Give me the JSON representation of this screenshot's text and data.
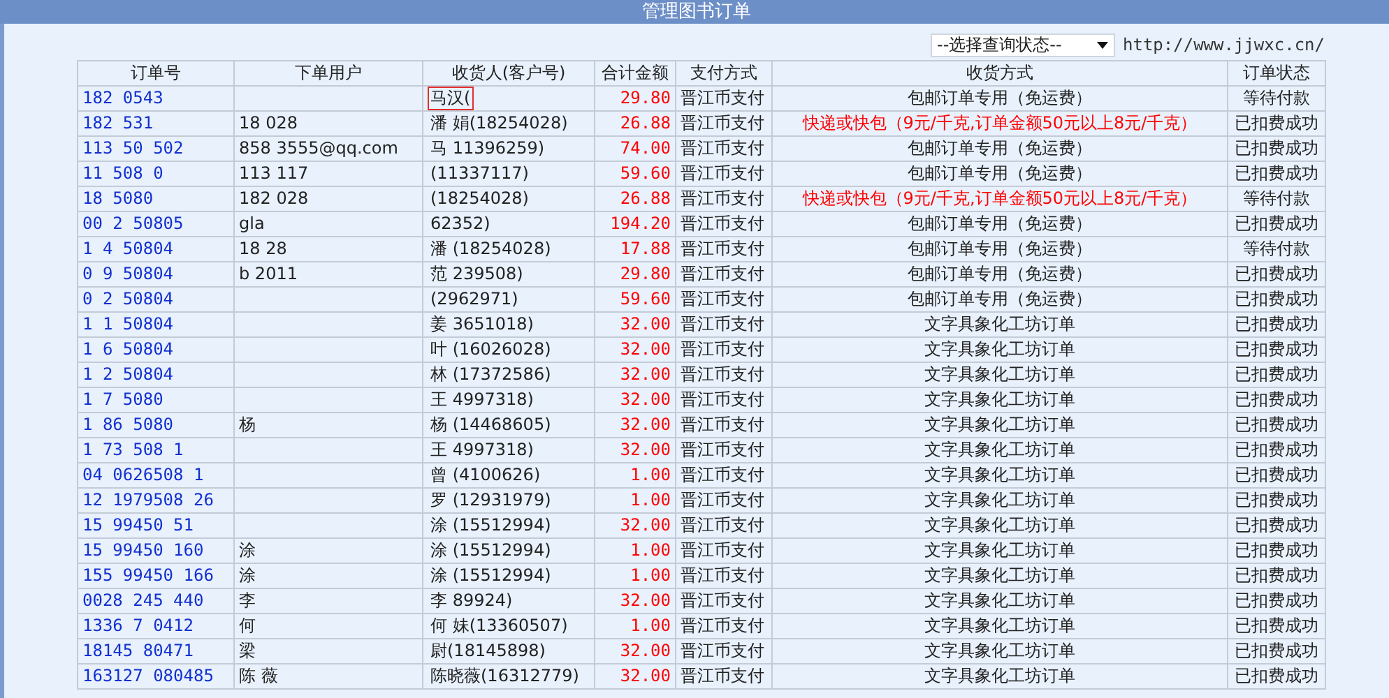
{
  "title": "管理图书订单",
  "status_filter": {
    "value": "--选择查询状态--"
  },
  "site_url": "http://www.jjwxc.cn/",
  "columns": [
    "订单号",
    "下单用户",
    "收货人(客户号)",
    "合计金额",
    "支付方式",
    "收货方式",
    "订单状态"
  ],
  "rows": [
    {
      "order": "182 0543",
      "consignee": "马汉(",
      "consignee_marked": true,
      "amount": "29.80",
      "payment": "晋江币支付",
      "shipping": "包邮订单专用（免运费）",
      "shipping_highlight": false,
      "status": "等待付款"
    },
    {
      "order": "182 531",
      "user": "18 028",
      "consignee": "潘 娟(18254028)",
      "consignee_marked": false,
      "amount": "26.88",
      "payment": "晋江币支付",
      "shipping": "快递或快包（9元/千克,订单金额50元以上8元/千克）",
      "shipping_highlight": true,
      "status": "已扣费成功"
    },
    {
      "order": "113 50 502",
      "user": "858 3555@qq.com",
      "consignee": "马 11396259)",
      "consignee_marked": false,
      "amount": "74.00",
      "payment": "晋江币支付",
      "shipping": "包邮订单专用（免运费）",
      "shipping_highlight": false,
      "status": "已扣费成功"
    },
    {
      "order": "11 508 0",
      "user": "113 117",
      "consignee": "(11337117)",
      "consignee_marked": false,
      "amount": "59.60",
      "payment": "晋江币支付",
      "shipping": "包邮订单专用（免运费）",
      "shipping_highlight": false,
      "status": "已扣费成功"
    },
    {
      "order": "18 5080",
      "user": "182 028",
      "consignee": "(18254028)",
      "consignee_marked": false,
      "amount": "26.88",
      "payment": "晋江币支付",
      "shipping": "快递或快包（9元/千克,订单金额50元以上8元/千克）",
      "shipping_highlight": true,
      "status": "等待付款"
    },
    {
      "order": "00 2 50805",
      "user": "gla",
      "consignee": "62352)",
      "consignee_marked": false,
      "amount": "194.20",
      "payment": "晋江币支付",
      "shipping": "包邮订单专用（免运费）",
      "shipping_highlight": false,
      "status": "已扣费成功"
    },
    {
      "order": "1 4 50804",
      "user": "18 28",
      "consignee": "潘 (18254028)",
      "consignee_marked": false,
      "amount": "17.88",
      "payment": "晋江币支付",
      "shipping": "包邮订单专用（免运费）",
      "shipping_highlight": false,
      "status": "等待付款"
    },
    {
      "order": "0 9 50804",
      "user": "b 2011",
      "consignee": "范 239508)",
      "consignee_marked": false,
      "amount": "29.80",
      "payment": "晋江币支付",
      "shipping": "包邮订单专用（免运费）",
      "shipping_highlight": false,
      "status": "已扣费成功"
    },
    {
      "order": "0 2 50804",
      "consignee": "(2962971)",
      "consignee_marked": false,
      "amount": "59.60",
      "payment": "晋江币支付",
      "shipping": "包邮订单专用（免运费）",
      "shipping_highlight": false,
      "status": "已扣费成功"
    },
    {
      "order": "1 1 50804",
      "consignee": "姜 3651018)",
      "consignee_marked": false,
      "amount": "32.00",
      "payment": "晋江币支付",
      "shipping": "文字具象化工坊订单",
      "shipping_highlight": false,
      "status": "已扣费成功"
    },
    {
      "order": "1 6 50804",
      "consignee": "叶 (16026028)",
      "consignee_marked": false,
      "amount": "32.00",
      "payment": "晋江币支付",
      "shipping": "文字具象化工坊订单",
      "shipping_highlight": false,
      "status": "已扣费成功"
    },
    {
      "order": "1 2 50804",
      "consignee": "林 (17372586)",
      "consignee_marked": false,
      "amount": "32.00",
      "payment": "晋江币支付",
      "shipping": "文字具象化工坊订单",
      "shipping_highlight": false,
      "status": "已扣费成功"
    },
    {
      "order": "1 7 5080",
      "consignee": "王 4997318)",
      "consignee_marked": false,
      "amount": "32.00",
      "payment": "晋江币支付",
      "shipping": "文字具象化工坊订单",
      "shipping_highlight": false,
      "status": "已扣费成功"
    },
    {
      "order": "1 86 5080",
      "user": "杨",
      "consignee": "杨 (14468605)",
      "consignee_marked": false,
      "amount": "32.00",
      "payment": "晋江币支付",
      "shipping": "文字具象化工坊订单",
      "shipping_highlight": false,
      "status": "已扣费成功"
    },
    {
      "order": "1 73 508 1",
      "consignee": "王 4997318)",
      "consignee_marked": false,
      "amount": "32.00",
      "payment": "晋江币支付",
      "shipping": "文字具象化工坊订单",
      "shipping_highlight": false,
      "status": "已扣费成功"
    },
    {
      "order": "04 0626508 1",
      "consignee": "曾 (4100626)",
      "consignee_marked": false,
      "amount": "1.00",
      "payment": "晋江币支付",
      "shipping": "文字具象化工坊订单",
      "shipping_highlight": false,
      "status": "已扣费成功"
    },
    {
      "order": "12 1979508 26",
      "consignee": "罗 (12931979)",
      "consignee_marked": false,
      "amount": "1.00",
      "payment": "晋江币支付",
      "shipping": "文字具象化工坊订单",
      "shipping_highlight": false,
      "status": "已扣费成功"
    },
    {
      "order": "15 99450 51",
      "consignee": "涂 (15512994)",
      "consignee_marked": false,
      "amount": "32.00",
      "payment": "晋江币支付",
      "shipping": "文字具象化工坊订单",
      "shipping_highlight": false,
      "status": "已扣费成功"
    },
    {
      "order": "15 99450 160",
      "user": "涂",
      "consignee": "涂 (15512994)",
      "consignee_marked": false,
      "amount": "1.00",
      "payment": "晋江币支付",
      "shipping": "文字具象化工坊订单",
      "shipping_highlight": false,
      "status": "已扣费成功"
    },
    {
      "order": "155 99450 166",
      "user": "涂",
      "consignee": "涂 (15512994)",
      "consignee_marked": false,
      "amount": "1.00",
      "payment": "晋江币支付",
      "shipping": "文字具象化工坊订单",
      "shipping_highlight": false,
      "status": "已扣费成功"
    },
    {
      "order": "0028 245 440",
      "user": "李",
      "consignee": "李 89924)",
      "consignee_marked": false,
      "amount": "32.00",
      "payment": "晋江币支付",
      "shipping": "文字具象化工坊订单",
      "shipping_highlight": false,
      "status": "已扣费成功"
    },
    {
      "order": "1336 7 0412",
      "user": "何",
      "consignee": "何 妹(13360507)",
      "consignee_marked": false,
      "amount": "1.00",
      "payment": "晋江币支付",
      "shipping": "文字具象化工坊订单",
      "shipping_highlight": false,
      "status": "已扣费成功"
    },
    {
      "order": "18145 80471",
      "user": "梁",
      "consignee": "尉(18145898)",
      "consignee_marked": false,
      "amount": "32.00",
      "payment": "晋江币支付",
      "shipping": "文字具象化工坊订单",
      "shipping_highlight": false,
      "status": "已扣费成功"
    },
    {
      "order": "163127 080485",
      "user": "陈 薇",
      "consignee": "陈晓薇(16312779)",
      "consignee_marked": false,
      "amount": "32.00",
      "payment": "晋江币支付",
      "shipping": "文字具象化工坊订单",
      "shipping_highlight": false,
      "status": "已扣费成功"
    }
  ]
}
